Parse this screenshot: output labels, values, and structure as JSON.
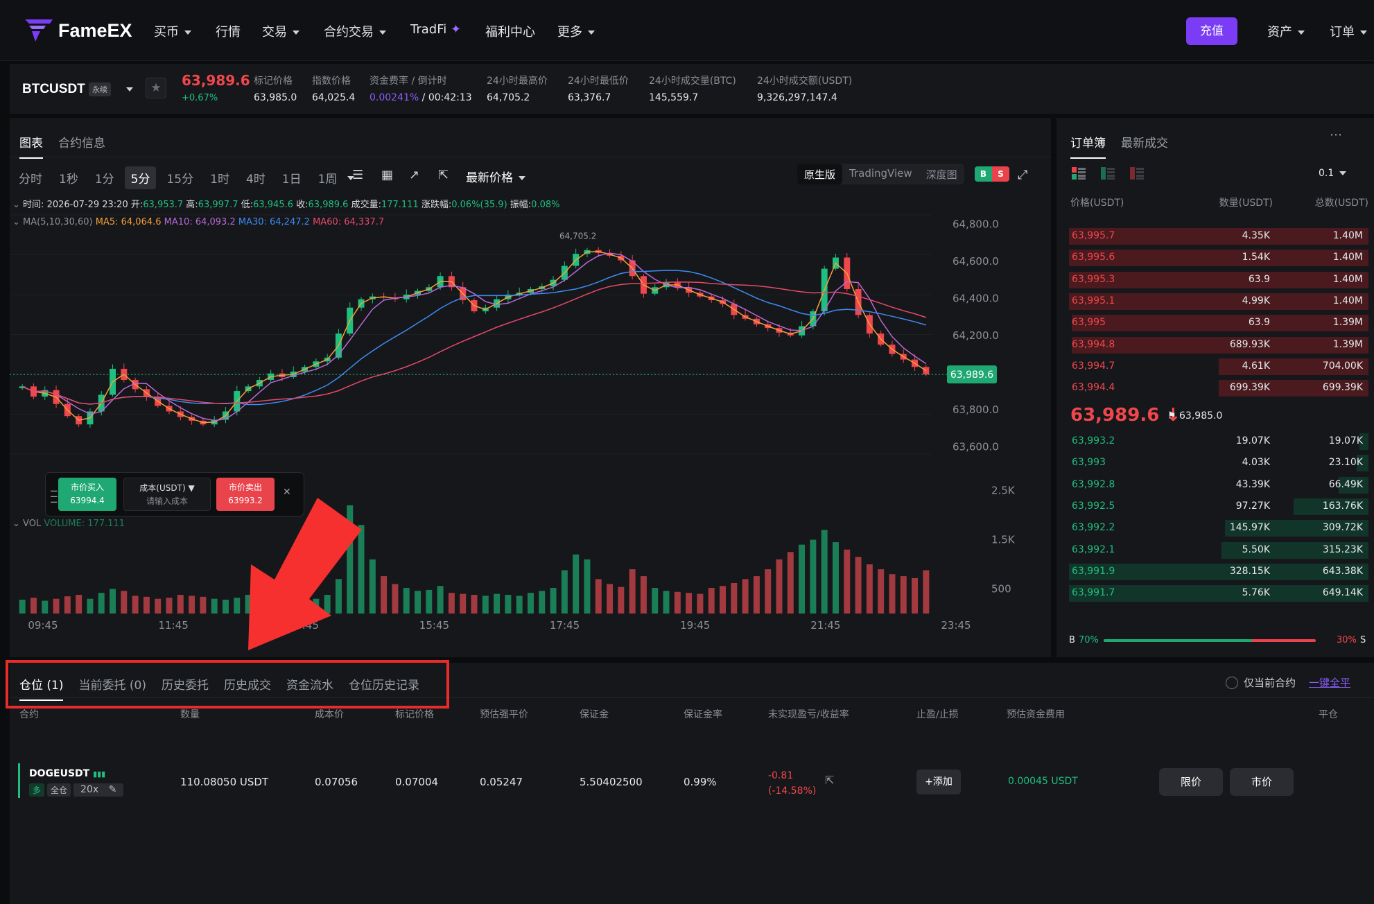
{
  "nav": {
    "logo": "FameEX",
    "items": [
      {
        "label": "买币",
        "caret": true
      },
      {
        "label": "行情",
        "caret": false
      },
      {
        "label": "交易",
        "caret": true
      },
      {
        "label": "合约交易",
        "caret": true
      },
      {
        "label": "TradFi",
        "caret": false
      },
      {
        "label": "福利中心",
        "caret": false
      },
      {
        "label": "更多",
        "caret": true
      }
    ],
    "deposit": "充值",
    "assets": "资产",
    "orders": "订单"
  },
  "ticker": {
    "symbol": "BTCUSDT",
    "perp": "永续",
    "last_price": "63,989.6",
    "change": "+0.67%",
    "stats": [
      {
        "label": "标记价格",
        "value": "63,985.0"
      },
      {
        "label": "指数价格",
        "value": "64,025.4"
      },
      {
        "label": "资金费率 / 倒计时",
        "value_a": "0.00241%",
        "value_b": " / 00:42:13"
      },
      {
        "label": "24小时最高价",
        "value": "64,705.2"
      },
      {
        "label": "24小时最低价",
        "value": "63,376.7"
      },
      {
        "label": "24小时成交量(BTC)",
        "value": "145,559.7"
      },
      {
        "label": "24小时成交额(USDT)",
        "value": "9,326,297,147.4"
      }
    ]
  },
  "chart_panel": {
    "tabs": [
      "图表",
      "合约信息"
    ],
    "timeframes": [
      "分时",
      "1秒",
      "1分",
      "5分",
      "15分",
      "1时",
      "4时",
      "1日",
      "1周"
    ],
    "active_timeframe": "5分",
    "price_type": "最新价格",
    "views": [
      "原生版",
      "TradingView",
      "深度图"
    ],
    "active_view": "原生版",
    "info": {
      "time_label": "时间:",
      "time": "2026-07-29 23:20",
      "open_label": "开:",
      "open": "63,953.7",
      "high_label": "高:",
      "high": "63,997.7",
      "low_label": "低:",
      "low": "63,945.6",
      "close_label": "收:",
      "close": "63,989.6",
      "vol_label": "成交量:",
      "vol": "177.111",
      "chg_label": "涨跌幅:",
      "chg": "0.06%(35.9)",
      "amp_label": "振幅:",
      "amp": "0.08%"
    },
    "ma": {
      "label": "MA(5,10,30,60)",
      "ma5": "MA5: 64,064.6",
      "ma10": "MA10: 64,093.2",
      "ma30": "MA30: 64,247.2",
      "ma60": "MA60: 64,337.7"
    },
    "vol_label": "VOL",
    "vol_value": "VOLUME: 177.111",
    "quick": {
      "buy": "市价买入",
      "buy_price": "63994.4",
      "cost": "成本(USDT)",
      "cost_placeholder": "请输入成本",
      "sell": "市价卖出",
      "sell_price": "63993.2"
    }
  },
  "chart_data": {
    "type": "candlestick",
    "title": "",
    "x_ticks": [
      "09:45",
      "11:45",
      "13:45",
      "15:45",
      "17:45",
      "19:45",
      "21:45",
      "23:45"
    ],
    "y_ticks": [
      "64,800.0",
      "64,600.0",
      "64,400.0",
      "64,200.0",
      "63,800.0",
      "63,600.0"
    ],
    "ylim": [
      63560,
      64850
    ],
    "vol_ticks": [
      "2.5K",
      "1.5K",
      "500"
    ],
    "vol_lim": [
      0,
      3100
    ],
    "high_marker": "64,705.2",
    "last_price_label": "63,989.6",
    "close": [
      63925,
      63870,
      63905,
      63830,
      63765,
      63720,
      63790,
      63880,
      64020,
      63960,
      63910,
      63870,
      63820,
      63790,
      63760,
      63740,
      63720,
      63745,
      63790,
      63900,
      63925,
      63960,
      63995,
      63975,
      64005,
      64030,
      64060,
      64080,
      64210,
      64350,
      64395,
      64410,
      64405,
      64395,
      64420,
      64440,
      64460,
      64520,
      64460,
      64390,
      64330,
      64350,
      64395,
      64420,
      64430,
      64450,
      64465,
      64500,
      64575,
      64640,
      64660,
      64645,
      64630,
      64605,
      64520,
      64425,
      64460,
      64485,
      64460,
      64430,
      64410,
      64390,
      64370,
      64310,
      64290,
      64260,
      64240,
      64215,
      64200,
      64250,
      64330,
      64560,
      64620,
      64450,
      64310,
      64210,
      64150,
      64100,
      64070,
      64030,
      63989.6
    ],
    "volume": [
      280,
      320,
      260,
      300,
      350,
      380,
      300,
      420,
      500,
      460,
      360,
      340,
      300,
      320,
      380,
      360,
      340,
      300,
      280,
      320,
      380,
      400,
      460,
      380,
      360,
      340,
      300,
      380,
      700,
      2200,
      1800,
      1100,
      760,
      600,
      520,
      460,
      480,
      560,
      420,
      400,
      380,
      360,
      400,
      380,
      360,
      420,
      460,
      520,
      880,
      1200,
      1100,
      700,
      600,
      540,
      900,
      760,
      520,
      460,
      440,
      420,
      400,
      520,
      560,
      620,
      700,
      760,
      900,
      1100,
      1250,
      1400,
      1500,
      1700,
      1450,
      1300,
      1150,
      1000,
      900,
      800,
      760,
      720,
      880
    ]
  },
  "orderbook": {
    "tabs": [
      "订单簿",
      "最新成交"
    ],
    "tick": "0.1",
    "headers": [
      "价格(USDT)",
      "数量(USDT)",
      "总数(USDT)"
    ],
    "asks": [
      {
        "price": "63,995.7",
        "qty": "4.35K",
        "total": "1.40M",
        "depth": 1.0
      },
      {
        "price": "63,995.6",
        "qty": "1.54K",
        "total": "1.40M",
        "depth": 1.0
      },
      {
        "price": "63,995.3",
        "qty": "63.9",
        "total": "1.40M",
        "depth": 1.0
      },
      {
        "price": "63,995.1",
        "qty": "4.99K",
        "total": "1.40M",
        "depth": 1.0
      },
      {
        "price": "63,995",
        "qty": "63.9",
        "total": "1.39M",
        "depth": 0.99
      },
      {
        "price": "63,994.8",
        "qty": "689.93K",
        "total": "1.39M",
        "depth": 0.99
      },
      {
        "price": "63,994.7",
        "qty": "4.61K",
        "total": "704.00K",
        "depth": 0.5
      },
      {
        "price": "63,994.4",
        "qty": "699.39K",
        "total": "699.39K",
        "depth": 0.5
      }
    ],
    "mid_price": "63,989.6 ↓",
    "mark_price": "63,985.0",
    "bids": [
      {
        "price": "63,993.2",
        "qty": "19.07K",
        "total": "19.07K",
        "depth": 0.03
      },
      {
        "price": "63,993",
        "qty": "4.03K",
        "total": "23.10K",
        "depth": 0.04
      },
      {
        "price": "63,992.8",
        "qty": "43.39K",
        "total": "66.49K",
        "depth": 0.1
      },
      {
        "price": "63,992.5",
        "qty": "97.27K",
        "total": "163.76K",
        "depth": 0.25
      },
      {
        "price": "63,992.2",
        "qty": "145.97K",
        "total": "309.72K",
        "depth": 0.48
      },
      {
        "price": "63,992.1",
        "qty": "5.50K",
        "total": "315.23K",
        "depth": 0.49
      },
      {
        "price": "63,991.9",
        "qty": "328.15K",
        "total": "643.38K",
        "depth": 1.0
      },
      {
        "price": "63,991.7",
        "qty": "5.76K",
        "total": "649.14K",
        "depth": 1.0
      }
    ],
    "ratio": {
      "buy_label": "B",
      "buy": "70%",
      "sell": "30%",
      "sell_label": "S",
      "buy_fraction": 0.7
    }
  },
  "positions": {
    "tabs": [
      "仓位 (1)",
      "当前委托 (0)",
      "历史委托",
      "历史成交",
      "资金流水",
      "仓位历史记录"
    ],
    "only_current": "仅当前合约",
    "close_all": "一键全平",
    "headers": [
      "合约",
      "数量",
      "成本价",
      "标记价格",
      "预估强平价",
      "保证金",
      "保证金率",
      "未实现盈亏/收益率",
      "止盈/止损",
      "预估资金费用",
      "平仓"
    ],
    "row": {
      "symbol": "DOGEUSDT",
      "side": "多",
      "mode": "全仓",
      "leverage": "20x",
      "qty": "110.08050 USDT",
      "cost": "0.07056",
      "mark": "0.07004",
      "liq": "0.05247",
      "margin": "5.50402500",
      "margin_rate": "0.99%",
      "pnl": "-0.81",
      "pnl_pct": "(-14.58%)",
      "add": "+添加",
      "funding": "0.00045 USDT",
      "limit": "限价",
      "market": "市价"
    }
  },
  "colors": {
    "up": "#1fbf80",
    "down": "#f0474c",
    "accent": "#7a3cf5",
    "highlight": "#e82b2b"
  }
}
